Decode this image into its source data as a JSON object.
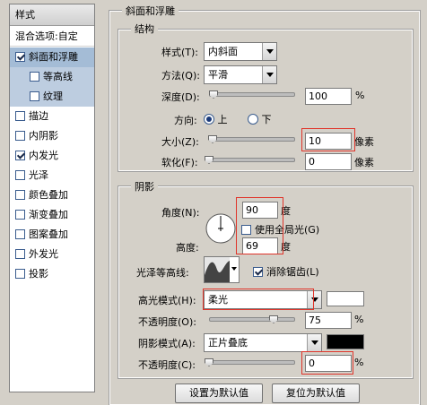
{
  "sidebar": {
    "header": "样式",
    "blend_options": "混合选项:自定",
    "items": [
      {
        "label": "斜面和浮雕",
        "checked": true,
        "active": true,
        "sub": false
      },
      {
        "label": "等高线",
        "checked": false,
        "active": false,
        "sub": true
      },
      {
        "label": "纹理",
        "checked": false,
        "active": false,
        "sub": true
      },
      {
        "label": "描边",
        "checked": false,
        "active": false,
        "sub": false
      },
      {
        "label": "内阴影",
        "checked": false,
        "active": false,
        "sub": false
      },
      {
        "label": "内发光",
        "checked": true,
        "active": false,
        "sub": false
      },
      {
        "label": "光泽",
        "checked": false,
        "active": false,
        "sub": false
      },
      {
        "label": "颜色叠加",
        "checked": false,
        "active": false,
        "sub": false
      },
      {
        "label": "渐变叠加",
        "checked": false,
        "active": false,
        "sub": false
      },
      {
        "label": "图案叠加",
        "checked": false,
        "active": false,
        "sub": false
      },
      {
        "label": "外发光",
        "checked": false,
        "active": false,
        "sub": false
      },
      {
        "label": "投影",
        "checked": false,
        "active": false,
        "sub": false
      }
    ]
  },
  "bevel": {
    "title": "斜面和浮雕",
    "structure": {
      "title": "结构",
      "style_label": "样式(T):",
      "style_value": "内斜面",
      "technique_label": "方法(Q):",
      "technique_value": "平滑",
      "depth_label": "深度(D):",
      "depth_value": "100",
      "depth_unit": "%",
      "depth_level": 0.05,
      "direction_label": "方向:",
      "direction_up": "上",
      "direction_down": "下",
      "size_label": "大小(Z):",
      "size_value": "10",
      "size_unit": "像素",
      "size_level": 0.04,
      "soften_label": "软化(F):",
      "soften_value": "0",
      "soften_unit": "像素",
      "soften_level": 0.0
    },
    "shading": {
      "title": "阴影",
      "angle_label": "角度(N):",
      "angle_value": "90",
      "angle_unit": "度",
      "global_light_label": "使用全局光(G)",
      "altitude_label": "高度:",
      "altitude_value": "69",
      "altitude_unit": "度",
      "gloss_contour_label": "光泽等高线:",
      "anti_aliased_label": "消除锯齿(L)",
      "highlight_mode_label": "高光模式(H):",
      "highlight_mode_value": "柔光",
      "highlight_color": "#ffffff",
      "highlight_opacity_label": "不透明度(O):",
      "highlight_opacity_value": "75",
      "highlight_opacity_unit": "%",
      "highlight_opacity_level": 0.75,
      "shadow_mode_label": "阴影模式(A):",
      "shadow_mode_value": "正片叠底",
      "shadow_color": "#000000",
      "shadow_opacity_label": "不透明度(C):",
      "shadow_opacity_value": "0",
      "shadow_opacity_unit": "%",
      "shadow_opacity_level": 0.0
    }
  },
  "buttons": {
    "set_default": "设置为默认值",
    "reset_default": "复位为默认值"
  }
}
